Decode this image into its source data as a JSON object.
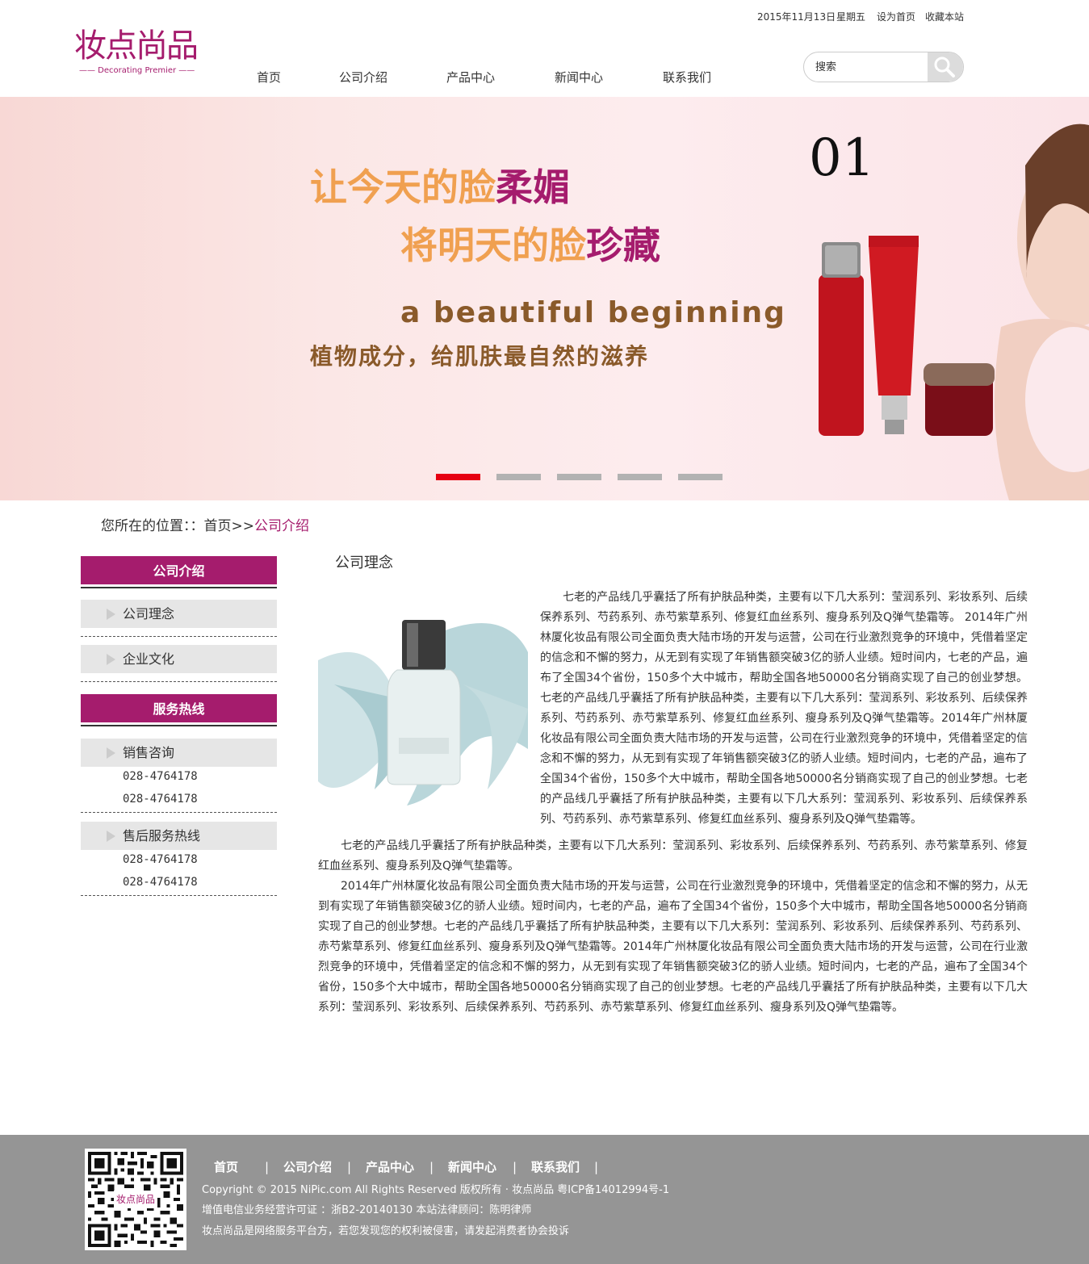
{
  "header": {
    "logo_text": "妆点尚品",
    "logo_sub": "—— Decorating Premier ——",
    "date": "2015年11月13日",
    "weekday": "星期五",
    "set_home": "设为首页",
    "bookmark": "收藏本站",
    "nav": [
      "首页",
      "公司介绍",
      "产品中心",
      "新闻中心",
      "联系我们"
    ],
    "search_placeholder": "搜索"
  },
  "banner": {
    "number": "01",
    "line1_a": "让今天的脸",
    "line1_b": "柔媚",
    "line2_a": "将明天的脸",
    "line2_b": "珍藏",
    "line3": "a beautiful beginning",
    "line4": "植物成分，给肌肤最自然的滋养",
    "active_slide": 1,
    "slide_count": 5
  },
  "breadcrumb": {
    "prefix": "您所在的位置：：首页>>",
    "current": "公司介绍"
  },
  "sidebar": {
    "section1_title": "公司介绍",
    "section1_items": [
      "公司理念",
      "企业文化"
    ],
    "section2_title": "服务热线",
    "sales_label": "销售咨询",
    "sales_phones": [
      "028-4764178",
      "028-4764178"
    ],
    "after_label": "售后服务热线",
    "after_phones": [
      "028-4764178",
      "028-4764178"
    ]
  },
  "content": {
    "title": "公司理念",
    "para_side": "七老的产品线几乎囊括了所有护肤品种类，主要有以下几大系列：莹润系列、彩妆系列、后续保养系列、芍药系列、赤芍紫草系列、修复红血丝系列、瘦身系列及Q弹气垫霜等。 2014年广州林厦化妆品有限公司全面负责大陆市场的开发与运营，公司在行业激烈竞争的环境中，凭借着坚定的信念和不懈的努力，从无到有实现了年销售额突破3亿的骄人业绩。短时间内，七老的产品，遍布了全国34个省份，150多个大中城市，帮助全国各地50000名分销商实现了自己的创业梦想。七老的产品线几乎囊括了所有护肤品种类，主要有以下几大系列：莹润系列、彩妆系列、后续保养系列、芍药系列、赤芍紫草系列、修复红血丝系列、瘦身系列及Q弹气垫霜等。2014年广州林厦化妆品有限公司全面负责大陆市场的开发与运营，公司在行业激烈竞争的环境中，凭借着坚定的信念和不懈的努力，从无到有实现了年销售额突破3亿的骄人业绩。短时间内，七老的产品，遍布了全国34个省份，150多个大中城市，帮助全国各地50000名分销商实现了自己的创业梦想。七老的产品线几乎囊括了所有护肤品种类，主要有以下几大系列：莹润系列、彩妆系列、后续保养系列、芍药系列、赤芍紫草系列、修复红血丝系列、瘦身系列及Q弹气垫霜等。",
    "para2": "七老的产品线几乎囊括了所有护肤品种类，主要有以下几大系列：莹润系列、彩妆系列、后续保养系列、芍药系列、赤芍紫草系列、修复红血丝系列、瘦身系列及Q弹气垫霜等。",
    "para3": "2014年广州林厦化妆品有限公司全面负责大陆市场的开发与运营，公司在行业激烈竞争的环境中，凭借着坚定的信念和不懈的努力，从无到有实现了年销售额突破3亿的骄人业绩。短时间内，七老的产品，遍布了全国34个省份，150多个大中城市，帮助全国各地50000名分销商实现了自己的创业梦想。七老的产品线几乎囊括了所有护肤品种类，主要有以下几大系列：莹润系列、彩妆系列、后续保养系列、芍药系列、赤芍紫草系列、修复红血丝系列、瘦身系列及Q弹气垫霜等。2014年广州林厦化妆品有限公司全面负责大陆市场的开发与运营，公司在行业激烈竞争的环境中，凭借着坚定的信念和不懈的努力，从无到有实现了年销售额突破3亿的骄人业绩。短时间内，七老的产品，遍布了全国34个省份，150多个大中城市，帮助全国各地50000名分销商实现了自己的创业梦想。七老的产品线几乎囊括了所有护肤品种类，主要有以下几大系列：莹润系列、彩妆系列、后续保养系列、芍药系列、赤芍紫草系列、修复红血丝系列、瘦身系列及Q弹气垫霜等。"
  },
  "footer": {
    "qr_label": "妆点尚品",
    "nav": [
      "首页",
      "公司介绍",
      "产品中心",
      "新闻中心",
      "联系我们"
    ],
    "copyright": "Copyright © 2015 NiPic.com All Rights Reserved  版权所有 · 妆点尚品  粤ICP备14012994号-1",
    "license": "增值电信业务经营许可证 ：浙B2-20140130 本站法律顾问：陈明律师",
    "notice": "妆点尚品是网络服务平台方，若您发现您的权利被侵害，请发起消费者协会投诉"
  },
  "colors": {
    "brand": "#a51c6d",
    "banner_orange": "#f0a050",
    "banner_brown": "#8a5a2a",
    "slide_active": "#e60012",
    "slide_inactive": "#b2b2b2",
    "sidebar_item_bg": "#e6e6e6",
    "footer_bg": "#959595"
  },
  "icons": {
    "search": "search-icon",
    "sidebar_bullet": "triangle-right-icon",
    "footer_qr": "qr-code-icon"
  }
}
